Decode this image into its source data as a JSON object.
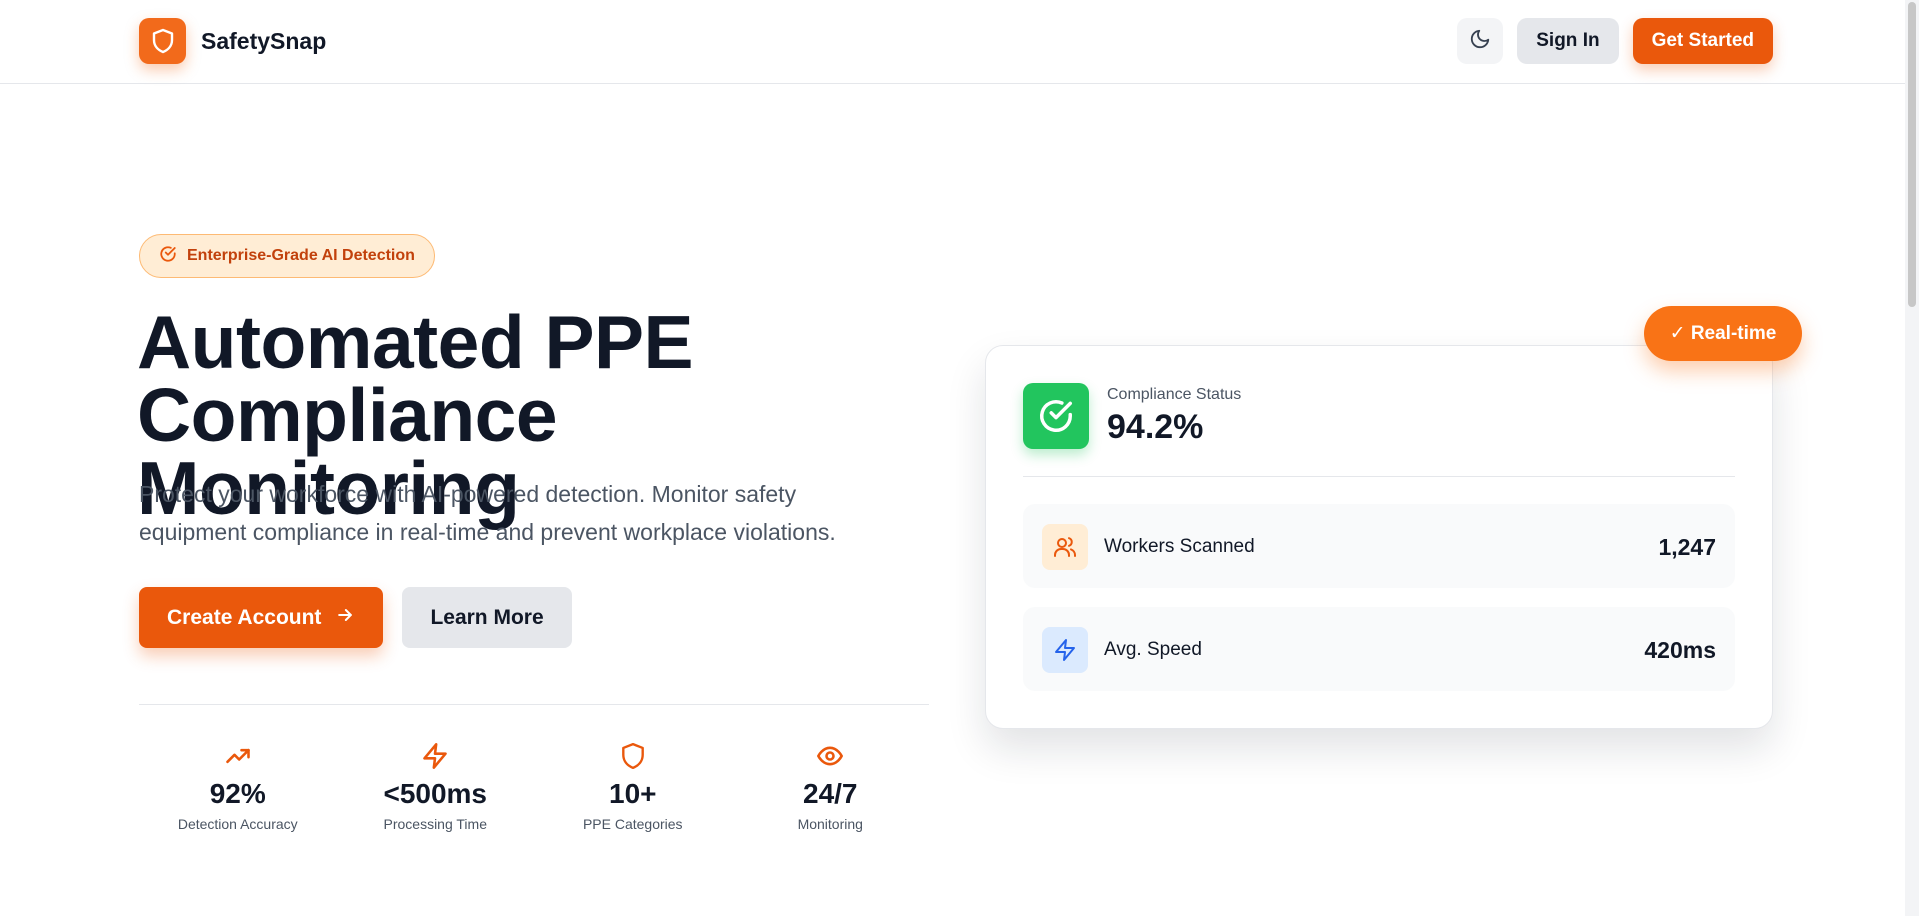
{
  "header": {
    "brand_name": "SafetySnap",
    "sign_in": "Sign In",
    "get_started": "Get Started"
  },
  "hero": {
    "badge": "Enterprise-Grade AI Detection",
    "title_line1": "Automated PPE",
    "title_line2": "Compliance Monitoring",
    "subtitle_line1": "Protect your workforce with AI-powered detection. Monitor safety",
    "subtitle_line2": "equipment compliance in real-time and prevent workplace violations.",
    "create_account": "Create Account",
    "learn_more": "Learn More"
  },
  "stats": [
    {
      "icon": "trending-up-icon",
      "value": "92%",
      "label": "Detection Accuracy"
    },
    {
      "icon": "zap-icon",
      "value": "<500ms",
      "label": "Processing Time"
    },
    {
      "icon": "shield-icon",
      "value": "10+",
      "label": "PPE Categories"
    },
    {
      "icon": "eye-icon",
      "value": "24/7",
      "label": "Monitoring"
    }
  ],
  "card": {
    "realtime_badge": "✓ Real-time",
    "compliance_label": "Compliance Status",
    "compliance_value": "94.2%",
    "metrics": [
      {
        "icon": "users-icon",
        "label": "Workers Scanned",
        "value": "1,247"
      },
      {
        "icon": "zap-icon",
        "label": "Avg. Speed",
        "value": "420ms"
      }
    ]
  },
  "colors": {
    "accent": "#ea580c",
    "accent_light": "#ffedd5",
    "success": "#22c55e",
    "text": "#111827",
    "muted": "#4b5563"
  }
}
